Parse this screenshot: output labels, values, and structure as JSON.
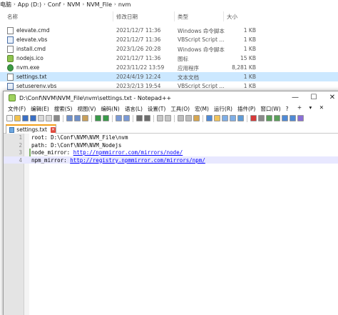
{
  "explorer": {
    "breadcrumb": [
      "电脑",
      "App (D:)",
      "Conf",
      "NVM",
      "NVM_File",
      "nvm"
    ],
    "columns": {
      "name": "名称",
      "date": "修改日期",
      "type": "类型",
      "size": "大小"
    },
    "files": [
      {
        "name": "elevate.cmd",
        "date": "2021/12/7 11:36",
        "type": "Windows 命令脚本",
        "size": "1 KB",
        "icon": "file-icon"
      },
      {
        "name": "elevate.vbs",
        "date": "2021/12/7 11:36",
        "type": "VBScript Script ...",
        "size": "1 KB",
        "icon": "vbs-file-icon"
      },
      {
        "name": "install.cmd",
        "date": "2023/1/26 20:28",
        "type": "Windows 命令脚本",
        "size": "1 KB",
        "icon": "file-icon"
      },
      {
        "name": "nodejs.ico",
        "date": "2021/12/7 11:36",
        "type": "图标",
        "size": "15 KB",
        "icon": "ico-file-icon"
      },
      {
        "name": "nvm.exe",
        "date": "2023/11/22 13:59",
        "type": "应用程序",
        "size": "8,281 KB",
        "icon": "exe-file-icon"
      },
      {
        "name": "settings.txt",
        "date": "2024/4/19 12:24",
        "type": "文本文档",
        "size": "1 KB",
        "icon": "txt-file-icon"
      },
      {
        "name": "setuserenv.vbs",
        "date": "2023/2/13 19:54",
        "type": "VBScript Script ...",
        "size": "1 KB",
        "icon": "vbs-file-icon"
      }
    ]
  },
  "notepad": {
    "title": "D:\\Conf\\NVM\\NVM_File\\nvm\\settings.txt - Notepad++",
    "window_controls": {
      "minimize": "—",
      "maximize": "☐",
      "close": "✕"
    },
    "menu": [
      "文件(F)",
      "编辑(E)",
      "搜索(S)",
      "视图(V)",
      "编码(N)",
      "语言(L)",
      "设置(T)",
      "工具(O)",
      "宏(M)",
      "运行(R)",
      "插件(P)",
      "窗口(W)",
      "?"
    ],
    "menu_right": "+ ▾ ✕",
    "tab_label": "settings.txt",
    "lines": [
      {
        "num": "1",
        "text": "root: D:\\Conf\\NVM\\NVM_File\\nvm",
        "url": ""
      },
      {
        "num": "2",
        "text": "path: D:\\Conf\\NVM\\NVM_Nodejs",
        "url": ""
      },
      {
        "num": "3",
        "text": "node_mirror: ",
        "url": "http://npmmirror.com/mirrors/node/"
      },
      {
        "num": "4",
        "text": "npm_mirror: ",
        "url": "http://registry.npmmirror.com/mirrors/npm/"
      }
    ],
    "toolbar_icons": [
      "new-file-icon",
      "open-file-icon",
      "save-icon",
      "save-all-icon",
      "close-icon",
      "close-all-icon",
      "print-icon",
      "cut-icon",
      "copy-icon",
      "paste-icon",
      "undo-icon",
      "redo-icon",
      "find-icon",
      "replace-icon",
      "zoom-in-icon",
      "zoom-out-icon",
      "sync-v-icon",
      "sync-h-icon",
      "word-wrap-icon",
      "all-chars-icon",
      "indent-guide-icon",
      "lang-icon",
      "folder-workspace-icon",
      "doc-map-icon",
      "function-list-icon",
      "monitor-icon",
      "record-macro-icon",
      "stop-macro-icon",
      "play-macro-icon",
      "run-macro-icon",
      "save-macro-icon",
      "spell-icon",
      "abc-icon"
    ]
  }
}
